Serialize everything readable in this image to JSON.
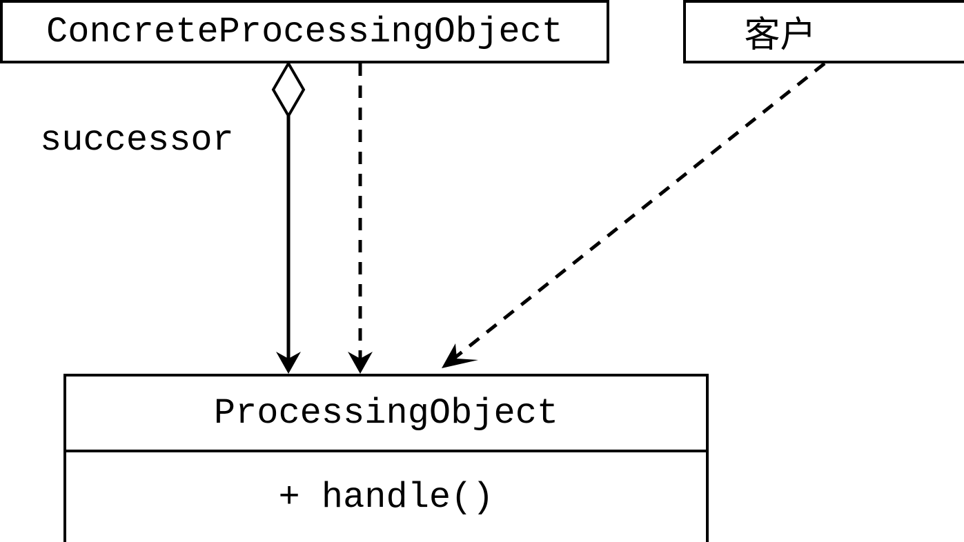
{
  "classes": {
    "concrete": {
      "name": "ConcreteProcessingObject"
    },
    "client": {
      "name": "客户"
    },
    "processing": {
      "name": "ProcessingObject",
      "method": "+ handle()"
    }
  },
  "relations": {
    "successor_label": "successor"
  }
}
